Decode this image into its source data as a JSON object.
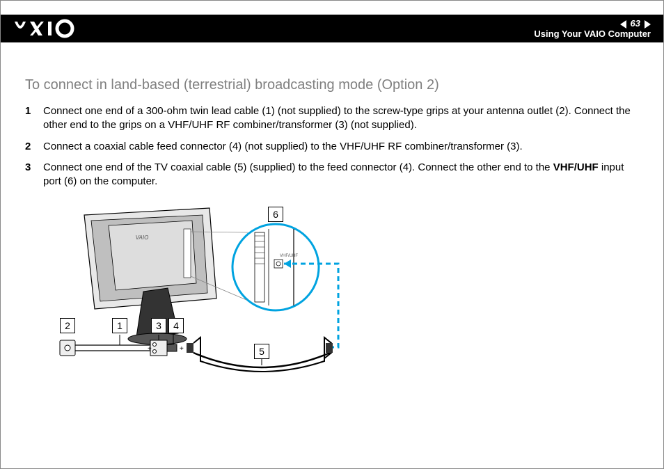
{
  "header": {
    "logo_text": "VAIO",
    "page_number": "63",
    "section": "Using Your VAIO Computer"
  },
  "article": {
    "title": "To connect in land-based (terrestrial) broadcasting mode (Option 2)",
    "steps": [
      {
        "num": "1",
        "text": "Connect one end of a 300-ohm twin lead cable (1) (not supplied) to the screw-type grips at your antenna outlet (2). Connect the other end to the grips on a VHF/UHF RF combiner/transformer (3) (not supplied)."
      },
      {
        "num": "2",
        "text": "Connect a coaxial cable feed connector (4) (not supplied) to the VHF/UHF RF combiner/transformer (3)."
      },
      {
        "num": "3",
        "text_pre": "Connect one end of the TV coaxial cable (5) (supplied) to the feed connector (4). Connect the other end to the ",
        "text_bold": "VHF/UHF",
        "text_post": " input port (6) on the computer."
      }
    ]
  },
  "diagram": {
    "callouts": {
      "c1": "1",
      "c2": "2",
      "c3": "3",
      "c4": "4",
      "c5": "5",
      "c6": "6"
    },
    "port_label": "VHF/UHF",
    "device_logo": "VAIO"
  }
}
